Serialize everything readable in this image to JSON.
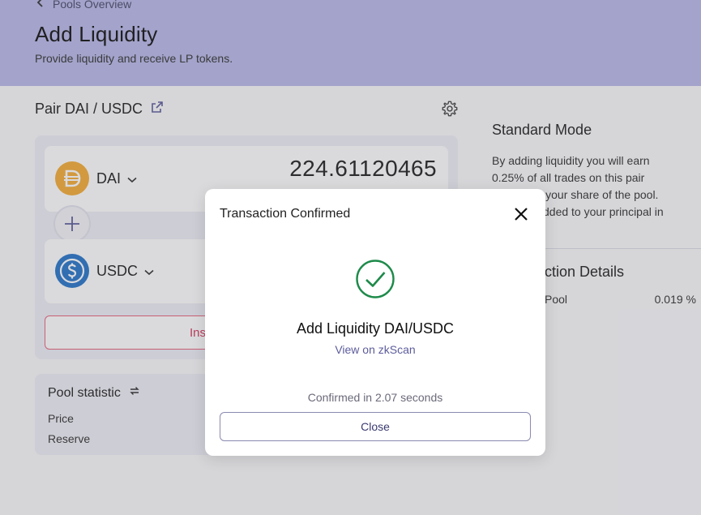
{
  "header": {
    "back_label": "Pools Overview",
    "title": "Add Liquidity",
    "subtitle": "Provide liquidity and receive LP tokens."
  },
  "pair": {
    "label": "Pair DAI / USDC",
    "external_link_icon": "external-link-icon",
    "settings_icon": "gear-icon"
  },
  "tokens": {
    "first": {
      "symbol": "DAI",
      "amount": "224.61120465",
      "icon": "dai-coin-icon",
      "color": "#f5ac37"
    },
    "second": {
      "symbol": "USDC",
      "icon": "usdc-coin-icon",
      "color": "#2775ca"
    }
  },
  "insufficient_label": "Ins",
  "pool_statistic": {
    "title": "Pool statistic",
    "price_label": "Price",
    "reserve_label": "Reserve"
  },
  "sidebar": {
    "mode_title": "Standard Mode",
    "description_lines": [
      "By adding liquidity you will earn",
      "0.25% of all trades on this pair",
      "nal to your share of the pool.",
      "dded to your principal in"
    ],
    "details_title": "ction Details",
    "pool_label": "Pool",
    "pool_value": "0.019 %"
  },
  "modal": {
    "title": "Transaction Confirmed",
    "heading": "Add Liquidity DAI/USDC",
    "link": "View on zkScan",
    "confirmed_text": "Confirmed in 2.07 seconds",
    "close_label": "Close"
  },
  "colors": {
    "accent": "#5c5c9c",
    "header_bg": "#b9b9e9",
    "success": "#1e8a4a",
    "danger": "#d7375c"
  }
}
